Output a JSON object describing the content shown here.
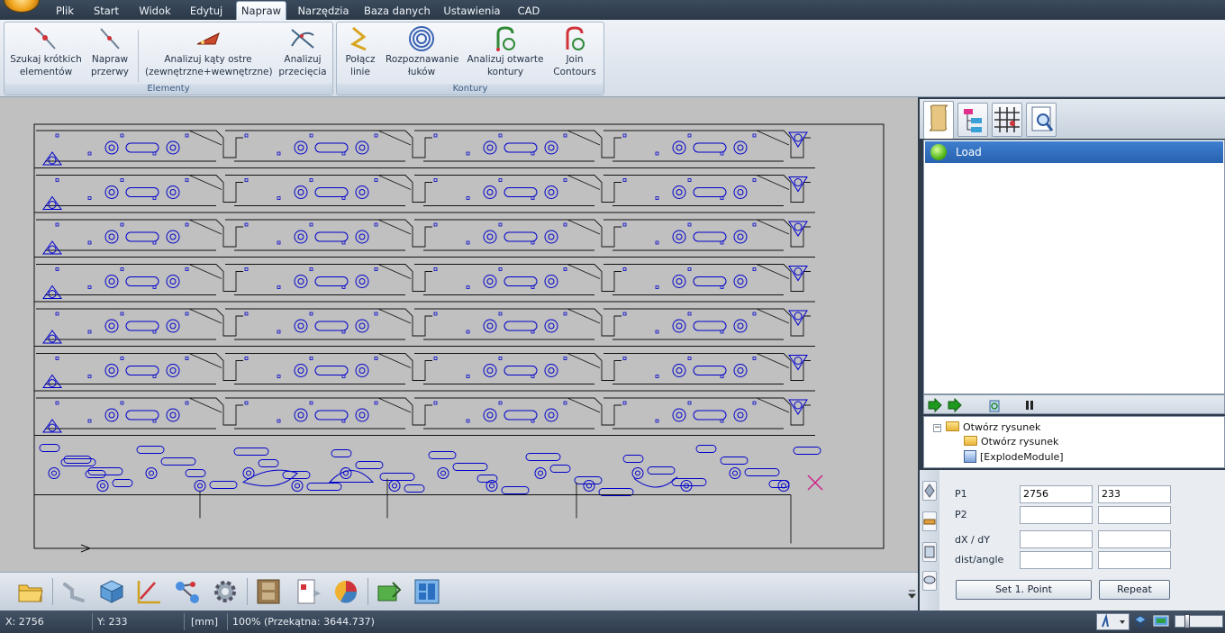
{
  "menu": {
    "tabs": [
      {
        "label": "Plik"
      },
      {
        "label": "Start"
      },
      {
        "label": "Widok"
      },
      {
        "label": "Edytuj"
      },
      {
        "label": "Napraw"
      },
      {
        "label": "Narzędzia"
      },
      {
        "label": "Baza danych"
      },
      {
        "label": "Ustawienia"
      },
      {
        "label": "CAD"
      }
    ],
    "active": "Napraw"
  },
  "ribbon": {
    "groups": [
      {
        "label": "Elementy"
      },
      {
        "label": "Kontury"
      }
    ],
    "buttons": [
      {
        "line1": "Szukaj krótkich",
        "line2": "elementów",
        "icon": "short-elements-icon"
      },
      {
        "line1": "Napraw",
        "line2": "przerwy",
        "icon": "repair-gaps-icon"
      },
      {
        "line1": "Analizuj kąty ostre",
        "line2": "(zewnętrzne+wewnętrzne)",
        "icon": "sharp-angles-icon"
      },
      {
        "line1": "Analizuj",
        "line2": "przecięcia",
        "icon": "intersections-icon"
      },
      {
        "line1": "Połącz",
        "line2": "linie",
        "icon": "join-lines-icon"
      },
      {
        "line1": "Rozpoznawanie",
        "line2": "łuków",
        "icon": "arc-recognition-icon"
      },
      {
        "line1": "Analizuj otwarte",
        "line2": "kontury",
        "icon": "open-contours-icon"
      },
      {
        "line1": "Join",
        "line2": "Contours",
        "icon": "join-contours-icon"
      }
    ]
  },
  "process": {
    "item": "Load"
  },
  "tree": {
    "root": "Otwórz rysunek",
    "child1": "Otwórz rysunek",
    "child2": "[ExplodeModule]"
  },
  "coords": {
    "p1_label": "P1",
    "p2_label": "P2",
    "dxdy_label": "dX / dY",
    "dist_label": "dist/angle",
    "p1_x": "2756",
    "p1_y": "233",
    "set_point": "Set 1. Point",
    "repeat": "Repeat"
  },
  "status": {
    "x": "X: 2756",
    "y": "Y: 233",
    "unit": "[mm]",
    "zoom": "100% (Przekątna: 3644.737)"
  },
  "colors": {
    "contour": "#0000cc",
    "outline": "#111111",
    "canvas": "#c0c0c0",
    "marker": "#cc2288",
    "selection": "#2f6cc0"
  }
}
